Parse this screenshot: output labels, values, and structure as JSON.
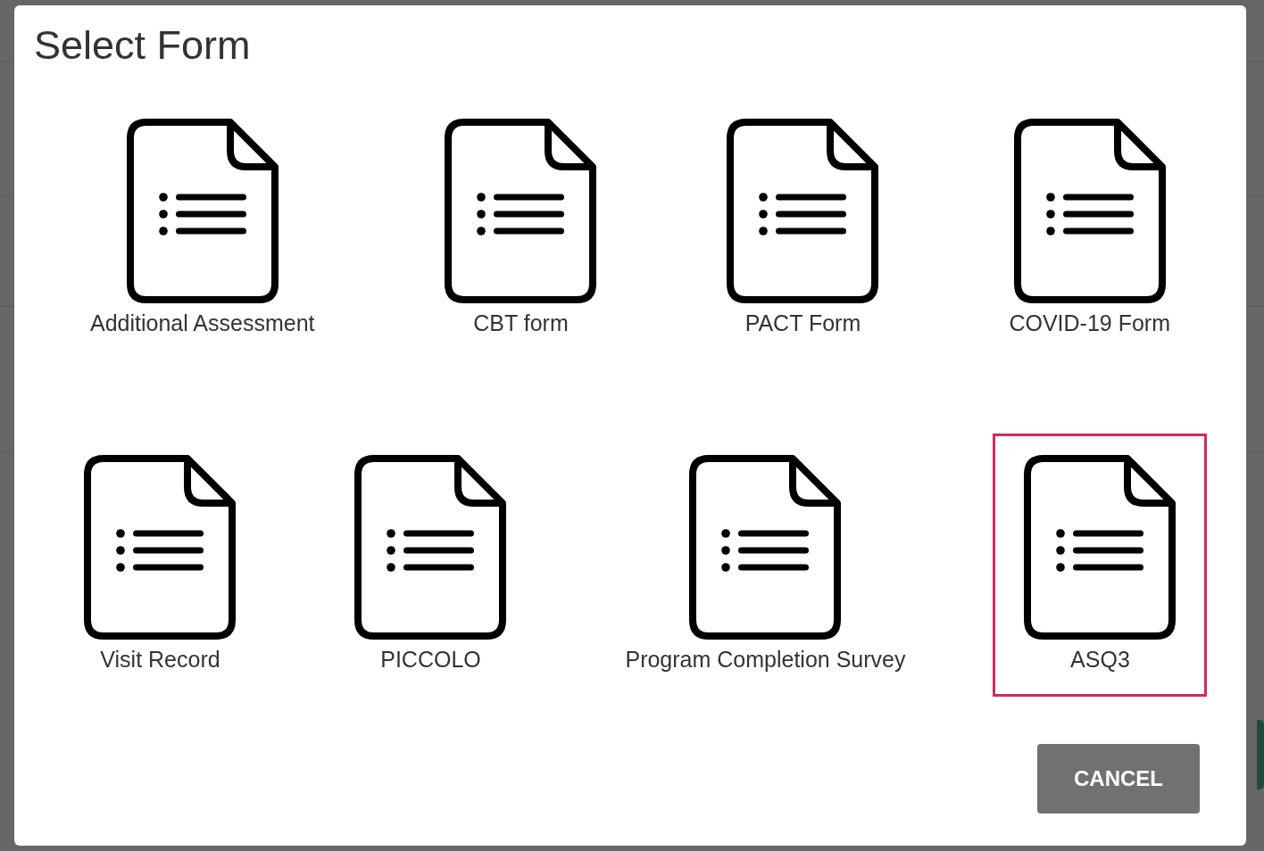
{
  "dialog": {
    "title": "Select Form",
    "forms": [
      {
        "label": "Additional Assessment",
        "selected": false
      },
      {
        "label": "CBT form",
        "selected": false
      },
      {
        "label": "PACT Form",
        "selected": false
      },
      {
        "label": "COVID-19 Form",
        "selected": false
      },
      {
        "label": "Visit Record",
        "selected": false
      },
      {
        "label": "PICCOLO",
        "selected": false
      },
      {
        "label": "Program Completion Survey",
        "selected": false
      },
      {
        "label": "ASQ3",
        "selected": true
      }
    ],
    "buttons": [
      {
        "label": "CANCEL"
      }
    ]
  }
}
